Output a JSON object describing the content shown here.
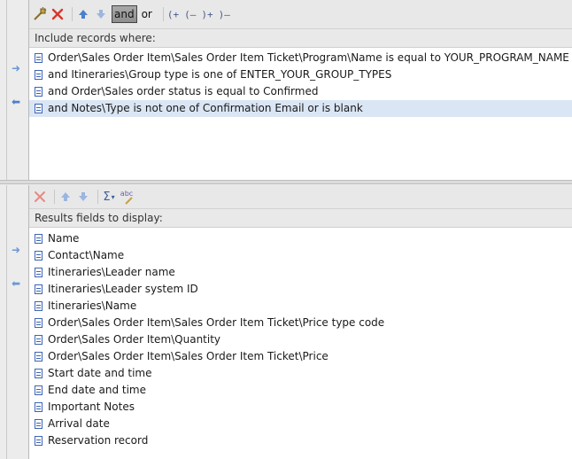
{
  "criteria": {
    "toolbar": {
      "and_label": "and",
      "or_label": "or",
      "open_paren_add": "(+",
      "open_paren_remove": "(–",
      "close_paren_add": ")+",
      "close_paren_remove": ")–"
    },
    "section_label": "Include records where:",
    "rows": [
      "Order\\Sales Order Item\\Sales Order Item Ticket\\Program\\Name is equal to YOUR_PROGRAM_NAME",
      "and Itineraries\\Group type is one of ENTER_YOUR_GROUP_TYPES",
      "and Order\\Sales order status is equal to Confirmed",
      "and Notes\\Type is not one of Confirmation Email or is blank"
    ],
    "selected_index": 3
  },
  "results": {
    "toolbar": {
      "sigma_label": "Σ",
      "abc_label": "abc"
    },
    "section_label": "Results fields to display:",
    "rows": [
      "Name",
      "Contact\\Name",
      "Itineraries\\Leader name",
      "Itineraries\\Leader system ID",
      "Itineraries\\Name",
      "Order\\Sales Order Item\\Sales Order Item Ticket\\Price type code",
      "Order\\Sales Order Item\\Quantity",
      "Order\\Sales Order Item\\Sales Order Item Ticket\\Price",
      "Start date and time",
      "End date and time",
      "Important Notes",
      "Arrival date",
      "Reservation record"
    ]
  },
  "colors": {
    "accent": "#4c7fcb",
    "selection": "#dbe6f5",
    "delete_red": "#d9352b"
  }
}
